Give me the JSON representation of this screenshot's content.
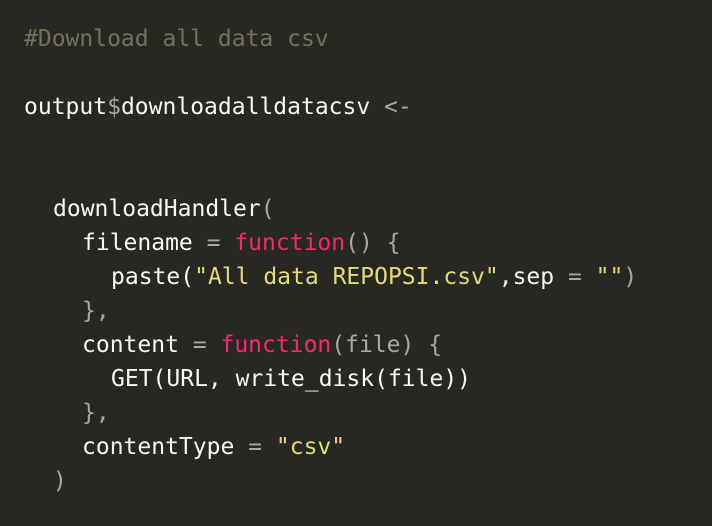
{
  "code": {
    "l1_comment": "#Download all data csv",
    "l2_obj": "output",
    "l2_dollar": "$",
    "l2_field": "downloadalldatacsv",
    "l2_assign": " <-",
    "l3_fn": "downloadHandler",
    "l3_open": "(",
    "l4_arg": "filename",
    "l4_eq": " = ",
    "l4_kw": "function",
    "l4_rest": "() {",
    "l5_fn": "paste(",
    "l5_str": "\"All data REPOPSI.csv\"",
    "l5_mid": ",sep",
    "l5_eq": " = ",
    "l5_str2": "\"\"",
    "l5_close": ")",
    "l6_close": "},",
    "l7_arg": "content",
    "l7_eq": " = ",
    "l7_kw": "function",
    "l7_rest": "(file) {",
    "l8_text": "GET(URL, write_disk(file))",
    "l9_close": "},",
    "l10_arg": "contentType",
    "l10_eq": " = ",
    "l10_str": "\"csv\"",
    "l11_close": ")"
  },
  "colors": {
    "background": "#272822",
    "comment": "#75715e",
    "keyword": "#f92672",
    "string": "#e6db74",
    "text": "#f8f8f2"
  }
}
